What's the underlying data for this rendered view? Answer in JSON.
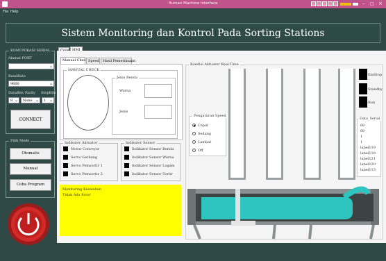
{
  "window": {
    "title": "Human Machine Interface"
  },
  "menu": {
    "file": "File",
    "help": "Help"
  },
  "header": {
    "title": "Sistem Monitoring dan Kontrol Pada Sorting Stations"
  },
  "serial": {
    "group": "KOMUNIKASI SERIAL",
    "port_label": "Alamat PORT",
    "port_value": "",
    "baud_label": "BaudRate",
    "baud_value": "9600",
    "databits_label": "DataBits",
    "parity_label": "Parity",
    "stopbits_label": "StopBits",
    "databits_value": "8",
    "parity_value": "None",
    "stopbits_value": "1",
    "connect": "CONNECT"
  },
  "mode": {
    "group": "Pilih Mode",
    "otomatis": "Otomatis",
    "manual": "Manual",
    "coba": "Coba Program"
  },
  "outer_tabs": [
    "Cover",
    "HMI"
  ],
  "inner_tabs": [
    "Manual Check",
    "Speed",
    "Hasil Pemeriksaan"
  ],
  "manual_check": {
    "group": "MANUAL CHECK",
    "jenis_benda_group": "Jenis Benda",
    "warna_label": "Warna",
    "jenis_label": "Jenis"
  },
  "aktuator": {
    "group": "Indikator Aktuator",
    "items": [
      "Motor Conveyor",
      "Servo Gerbang",
      "Servo Pemsortir 1",
      "Servo Pemsortir 2"
    ]
  },
  "sensor": {
    "group": "Indikator Sensor",
    "items": [
      "Indikator Sensor Benda",
      "Indikator Sensor Warna",
      "Indikator Sensor Logam",
      "Indikator Sensor Sortir"
    ]
  },
  "monitor": {
    "title": "Monitoring Kesalahan",
    "status": "Tidak Ada Error"
  },
  "kondisi": {
    "title": "Kondisi Aktuator Real-Time"
  },
  "speed": {
    "group": "Pengaturan Speed",
    "options": [
      "Cepat",
      "Sedang",
      "Lambat",
      "Off"
    ],
    "selected": "Cepat"
  },
  "controls": {
    "emstop": "EmStop",
    "standby": "Standby",
    "run": "Run"
  },
  "data_serial": {
    "group": "Data_Serial",
    "items": [
      "60",
      "60",
      "1",
      "1",
      "label119",
      "label118",
      "label121",
      "label120",
      "label113"
    ]
  },
  "colors": {
    "accent": "#2ec4c0",
    "panel": "#2f4a46",
    "warning": "#ffff00",
    "titlebar": "#c0548a"
  },
  "icons": {
    "emergency": "emergency-stop-icon"
  }
}
